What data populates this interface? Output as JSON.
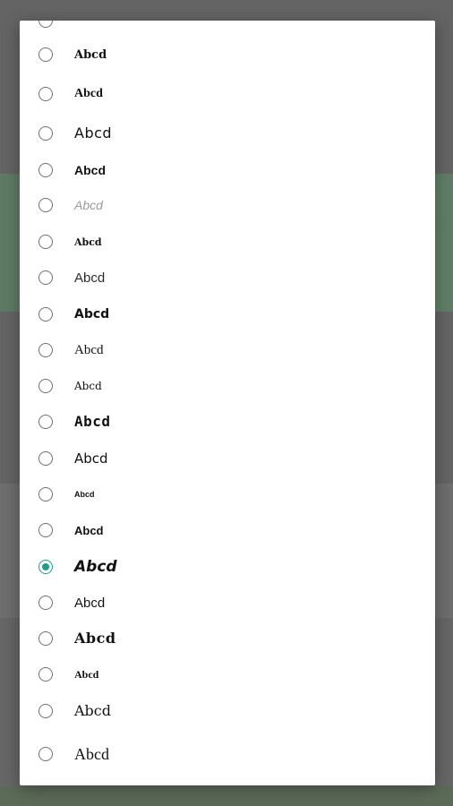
{
  "dialog": {
    "selected_index": 14,
    "accent_color": "#1f9e8c",
    "options": [
      {
        "label": "Abcd",
        "style": "f-serif-b"
      },
      {
        "label": "Abcd",
        "style": "f-serif"
      },
      {
        "label": "Abcd",
        "style": "f-sans-l"
      },
      {
        "label": "Abcd",
        "style": "f-sans-b"
      },
      {
        "label": "Abcd",
        "style": "f-ghost"
      },
      {
        "label": "Abcd",
        "style": "f-black"
      },
      {
        "label": "Abcd",
        "style": "f-light"
      },
      {
        "label": "Abcd",
        "style": "f-bold-m"
      },
      {
        "label": "Abcd",
        "style": "f-serif-m"
      },
      {
        "label": "Abcd",
        "style": "f-small"
      },
      {
        "label": "Abcd",
        "style": "f-wide"
      },
      {
        "label": "Abcd",
        "style": "f-sans-m"
      },
      {
        "label": "Abcd",
        "style": "f-tiny"
      },
      {
        "label": "Abcd",
        "style": "f-sans-b2"
      },
      {
        "label": "Abcd",
        "style": "f-italic"
      },
      {
        "label": "Abcd",
        "style": "f-plain"
      },
      {
        "label": "Abcd",
        "style": "f-gothic"
      },
      {
        "label": "Abcd",
        "style": "f-cond"
      },
      {
        "label": "Abcd",
        "style": "f-serif-l"
      },
      {
        "label": "Abcd",
        "style": "f-serif-l2"
      }
    ]
  }
}
